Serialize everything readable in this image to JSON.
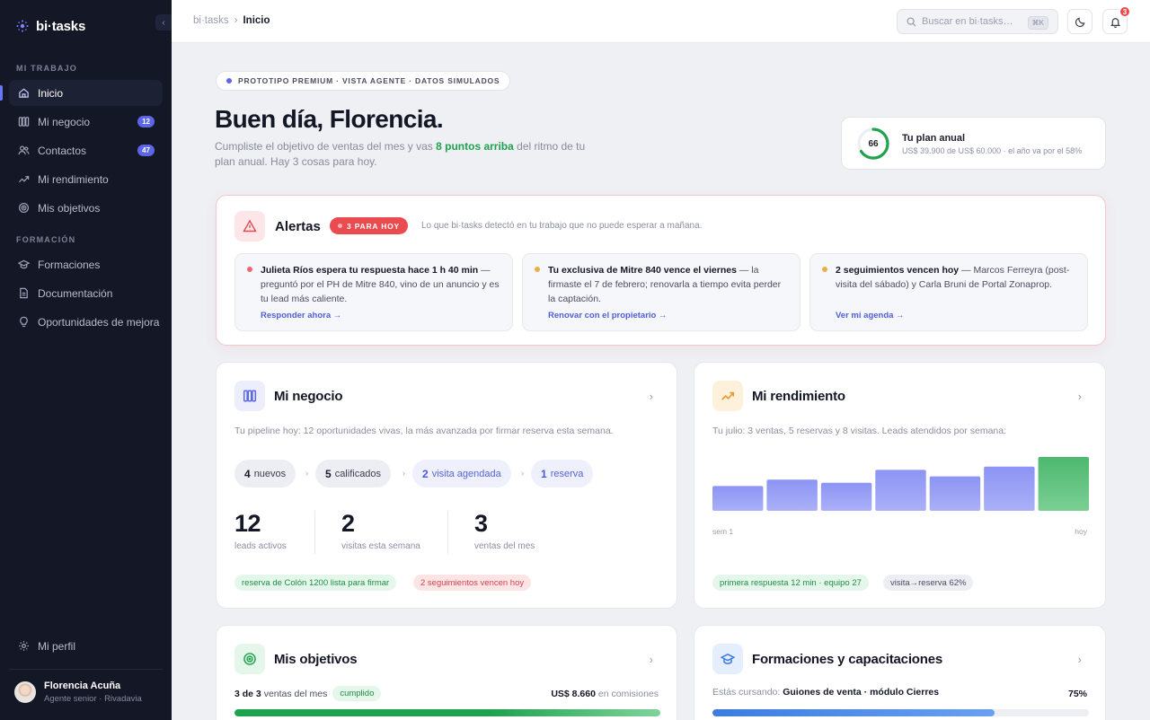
{
  "brand": {
    "name": "bi·tasks"
  },
  "sidebar": {
    "section_work": "MI TRABAJO",
    "section_training": "FORMACIÓN",
    "items": [
      {
        "label": "Inicio",
        "icon": "home-icon"
      },
      {
        "label": "Mi negocio",
        "icon": "kanban-icon",
        "badge": "12"
      },
      {
        "label": "Contactos",
        "icon": "users-icon",
        "badge": "47"
      },
      {
        "label": "Mi rendimiento",
        "icon": "trending-up-icon"
      },
      {
        "label": "Mis objetivos",
        "icon": "target-icon"
      },
      {
        "label": "Formaciones",
        "icon": "graduation-cap-icon"
      },
      {
        "label": "Documentación",
        "icon": "document-icon"
      },
      {
        "label": "Oportunidades de mejora",
        "icon": "lightbulb-icon"
      }
    ],
    "profile_link": "Mi perfil",
    "user": {
      "name": "Florencia Acuña",
      "role": "Agente senior · Rivadavia"
    }
  },
  "topbar": {
    "crumb_root": "bi·tasks",
    "crumb_sep": "›",
    "crumb_current": "Inicio",
    "search_placeholder": "Buscar en bi·tasks…",
    "search_shortcut": "⌘K",
    "notif_count": "3"
  },
  "banner": {
    "label": "PROTOTIPO PREMIUM · VISTA AGENTE · DATOS SIMULADOS"
  },
  "greeting": {
    "title": "Buen día, Florencia.",
    "line_pre": "Cumpliste el objetivo de ventas del mes y vas ",
    "line_highlight": "8 puntos arriba",
    "line_post": " del ritmo de tu plan anual. Hay 3 cosas para hoy."
  },
  "plan": {
    "value": 66,
    "value_label": "66",
    "title": "Tu plan anual",
    "subtitle": "US$ 39.900 de US$ 60.000 · el año va por el 58%",
    "color": "#22a24f"
  },
  "alerts": {
    "title": "Alertas",
    "badge": "3 PARA HOY",
    "description": "Lo que bi·tasks detectó en tu trabajo que no puede esperar a mañana.",
    "items": [
      {
        "bold": "Julieta Ríos espera tu respuesta hace 1 h 40 min",
        "rest": " — preguntó por el PH de Mitre 840, vino de un anuncio y es tu lead más caliente.",
        "link": "Responder ahora →",
        "dot": "#ec6a6f"
      },
      {
        "bold": "Tu exclusiva de Mitre 840 vence el viernes",
        "rest": " — la firmaste el 7 de febrero; renovarla a tiempo evita perder la captación.",
        "link": "Renovar con el propietario →",
        "dot": "#efae4d"
      },
      {
        "bold": "2 seguimientos vencen hoy",
        "rest": " — Marcos Ferreyra (post-visita del sábado) y Carla Bruni de Portal Zonaprop.",
        "link": "Ver mi agenda →",
        "dot": "#efae4d"
      }
    ]
  },
  "business": {
    "title": "Mi negocio",
    "description": "Tu pipeline hoy: 12 oportunidades vivas, la más avanzada por firmar reserva esta semana.",
    "stages": [
      {
        "count": "4",
        "label": "nuevos"
      },
      {
        "count": "5",
        "label": "calificados"
      },
      {
        "count": "2",
        "label": "visita agendada"
      },
      {
        "count": "1",
        "label": "reserva"
      }
    ],
    "stage_sep": "›",
    "stats": [
      {
        "value": "12",
        "label": "leads activos"
      },
      {
        "value": "2",
        "label": "visitas esta semana"
      },
      {
        "value": "3",
        "label": "ventas del mes"
      }
    ],
    "tags": [
      {
        "label": "reserva de Colón 1200 lista para firmar"
      },
      {
        "label": "2 seguimientos vencen hoy"
      }
    ]
  },
  "performance": {
    "title": "Mi rendimiento",
    "description": "Tu julio: 3 ventas, 5 reservas y 8 visitas. Leads atendidos por semana:",
    "axis_start": "sem 1",
    "axis_end": "hoy",
    "tags": [
      {
        "label": "primera respuesta 12 min · equipo 27"
      },
      {
        "label": "visita→reserva 62%"
      }
    ]
  },
  "chart_data": {
    "type": "bar",
    "categories": [
      "sem 1",
      "",
      "",
      "",
      "",
      "",
      "hoy"
    ],
    "values": [
      46,
      58,
      52,
      76,
      64,
      82,
      100
    ],
    "ylim": [
      0,
      100
    ],
    "grid": false,
    "colors": {
      "bar": "#8b93f3",
      "last": "#4fb971"
    }
  },
  "objectives": {
    "title": "Mis objetivos",
    "count_bold": "3 de 3",
    "count_rest": "ventas del mes",
    "chip": "cumplido",
    "commission_bold": "US$ 8.660",
    "commission_rest": "en comisiones",
    "progress": 1.0
  },
  "training": {
    "title": "Formaciones y capacitaciones",
    "pre": "Estás cursando:",
    "course": "Guiones de venta · módulo Cierres",
    "percent": "75%",
    "progress": 0.75
  }
}
